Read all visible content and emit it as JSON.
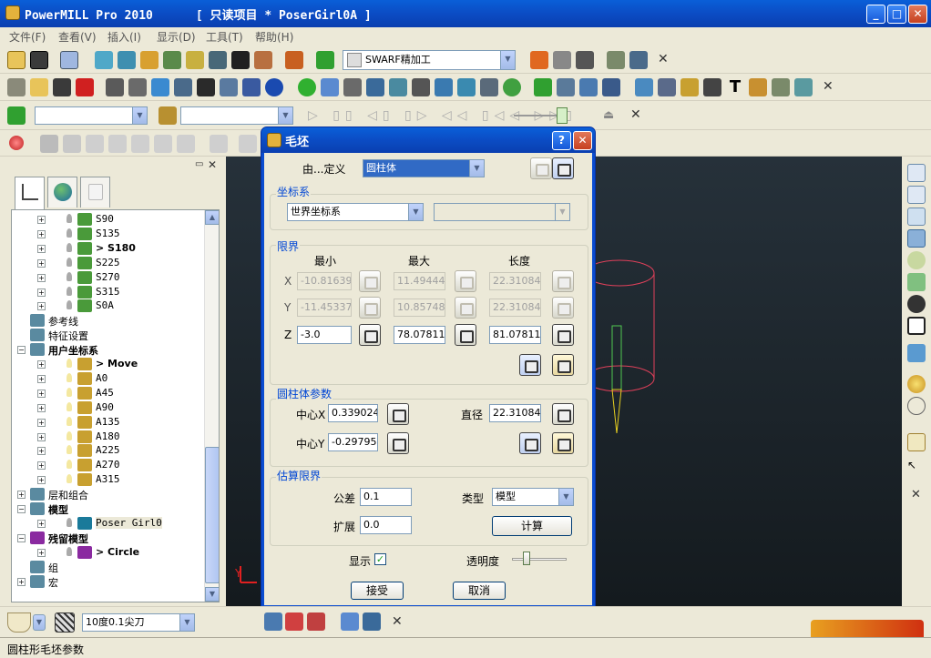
{
  "window": {
    "title": "PowerMILL Pro 2010      [ 只读项目 * PoserGirl0A ]"
  },
  "menu": [
    "文件(F)",
    "查看(V)",
    "插入(I)",
    "显示(D)",
    "工具(T)",
    "帮助(H)"
  ],
  "toolbar1": {
    "strategy_combo": "SWARF精加工"
  },
  "toolbar3": {
    "combo1": "",
    "combo2": ""
  },
  "tree": {
    "items": [
      {
        "label": "S90",
        "kind": "child",
        "style": "mono"
      },
      {
        "label": "S135",
        "kind": "child",
        "style": "mono"
      },
      {
        "label": "> S180",
        "kind": "child",
        "style": "bold"
      },
      {
        "label": "S225",
        "kind": "child",
        "style": "mono"
      },
      {
        "label": "S270",
        "kind": "child",
        "style": "mono"
      },
      {
        "label": "S315",
        "kind": "child",
        "style": "mono"
      },
      {
        "label": "S0A",
        "kind": "child",
        "style": "mono"
      },
      {
        "label": "参考线",
        "kind": "top",
        "style": ""
      },
      {
        "label": "特征设置",
        "kind": "top",
        "style": ""
      },
      {
        "label": "用户坐标系",
        "kind": "top",
        "style": "bold"
      },
      {
        "label": "> Move",
        "kind": "ucs",
        "style": "bold"
      },
      {
        "label": "A0",
        "kind": "ucs",
        "style": "mono"
      },
      {
        "label": "A45",
        "kind": "ucs",
        "style": "mono"
      },
      {
        "label": "A90",
        "kind": "ucs",
        "style": "mono"
      },
      {
        "label": "A135",
        "kind": "ucs",
        "style": "mono"
      },
      {
        "label": "A180",
        "kind": "ucs",
        "style": "mono"
      },
      {
        "label": "A225",
        "kind": "ucs",
        "style": "mono"
      },
      {
        "label": "A270",
        "kind": "ucs",
        "style": "mono"
      },
      {
        "label": "A315",
        "kind": "ucs",
        "style": "mono"
      },
      {
        "label": "层和组合",
        "kind": "top",
        "style": ""
      },
      {
        "label": "模型",
        "kind": "top",
        "style": "bold"
      },
      {
        "label": "Poser Girl0",
        "kind": "model",
        "style": "mono"
      },
      {
        "label": "残留模型",
        "kind": "top",
        "style": "bold"
      },
      {
        "label": "> Circle",
        "kind": "model",
        "style": "bold"
      },
      {
        "label": "组",
        "kind": "top",
        "style": ""
      },
      {
        "label": "宏",
        "kind": "top",
        "style": ""
      }
    ]
  },
  "dialog": {
    "title": "毛坯",
    "define_label": "由...定义",
    "define_value": "圆柱体",
    "coord_group": "坐标系",
    "coord_value": "世界坐标系",
    "coord_value2": "",
    "limits_group": "限界",
    "col_min": "最小",
    "col_max": "最大",
    "col_len": "长度",
    "row_x": "X",
    "row_y": "Y",
    "row_z": "Z",
    "x_min": "-10.81639",
    "x_max": "11.494444",
    "x_len": "22.31084",
    "y_min": "-11.45337",
    "y_max": "10.857486",
    "y_len": "22.31084",
    "z_min": "-3.0",
    "z_max": "78.07811",
    "z_len": "81.07811",
    "cyl_group": "圆柱体参数",
    "center_x_label": "中心X",
    "center_x": "0.339024",
    "diameter_label": "直径",
    "diameter": "22.31084",
    "center_y_label": "中心Y",
    "center_y": "-0.297951",
    "est_group": "估算限界",
    "tol_label": "公差",
    "tol": "0.1",
    "type_label": "类型",
    "type": "模型",
    "ext_label": "扩展",
    "ext": "0.0",
    "calc_button": "计算",
    "show_label": "显示",
    "transparency_label": "透明度",
    "accept_button": "接受",
    "cancel_button": "取消"
  },
  "bottom": {
    "tool_combo": "10度0.1尖刀"
  },
  "status": {
    "text": "圆柱形毛坯参数"
  },
  "viewport": {
    "axis_label": "Y"
  }
}
